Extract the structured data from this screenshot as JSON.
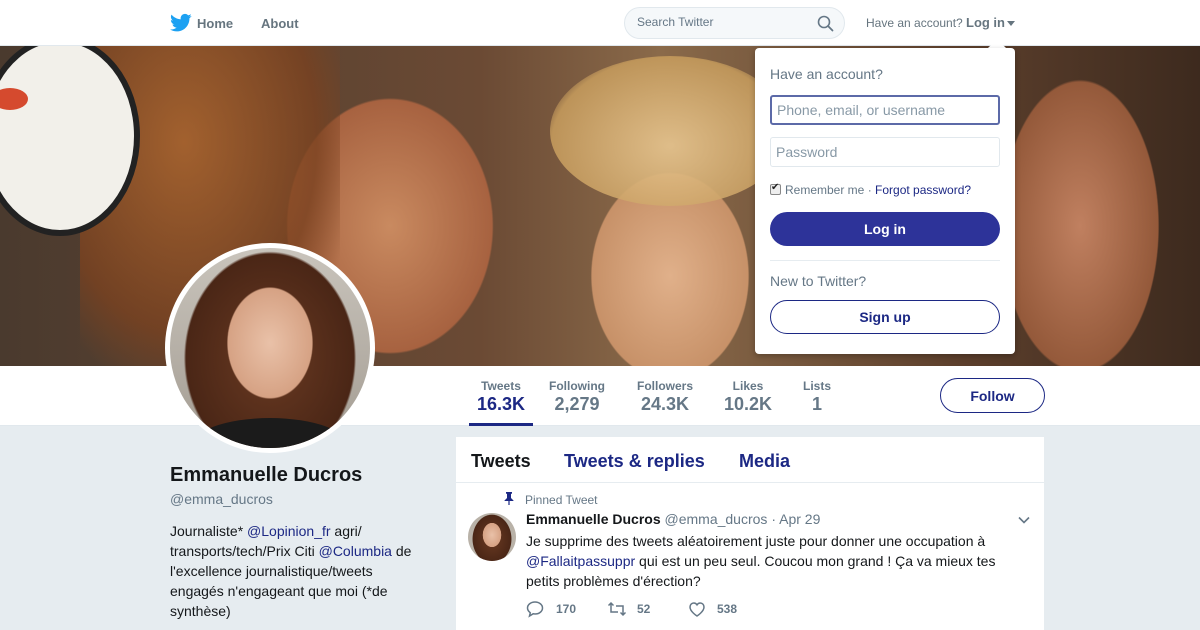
{
  "topnav": {
    "logo_icon": "twitter-bird-icon",
    "home_label": "Home",
    "about_label": "About",
    "search_placeholder": "Search Twitter",
    "have_account_label": "Have an account?",
    "login_label": "Log in",
    "brand_color": "#1da1f2"
  },
  "profile": {
    "name": "Emmanuelle Ducros",
    "handle": "@emma_ducros",
    "bio": {
      "part1": "Journaliste* ",
      "link1": "@Lopinion_fr",
      "part2": " agri/ transports/tech/Prix Citi ",
      "link2": "@Columbia",
      "part3": " de l'excellence journalistique/tweets engagés n'engageant que moi (*de synthèse)"
    },
    "follow_label": "Follow",
    "accent_color": "#1c2884"
  },
  "stats": [
    {
      "label": "Tweets",
      "value": "16.3K"
    },
    {
      "label": "Following",
      "value": "2,279"
    },
    {
      "label": "Followers",
      "value": "24.3K"
    },
    {
      "label": "Likes",
      "value": "10.2K"
    },
    {
      "label": "Lists",
      "value": "1"
    }
  ],
  "timeline": {
    "tabs": [
      "Tweets",
      "Tweets & replies",
      "Media"
    ],
    "pinned_label": "Pinned Tweet",
    "tweet": {
      "name": "Emmanuelle Ducros",
      "handle": "@emma_ducros",
      "separator": "·",
      "date": "Apr 29",
      "text_part1": "Je supprime des tweets aléatoirement juste pour donner une occupation à ",
      "mention": "@Fallaitpassuppr",
      "text_part2": " qui est un peu seul. Coucou mon grand ! Ça va mieux tes petits problèmes d'érection?",
      "replies": "170",
      "retweets": "52",
      "likes": "538"
    }
  },
  "login_dropdown": {
    "title": "Have an account?",
    "username_placeholder": "Phone, email, or username",
    "password_placeholder": "Password",
    "remember_label": "Remember me",
    "separator": " · ",
    "forgot_label": "Forgot password?",
    "login_button": "Log in",
    "new_label": "New to Twitter?",
    "signup_button": "Sign up",
    "button_color": "#2d3399"
  }
}
